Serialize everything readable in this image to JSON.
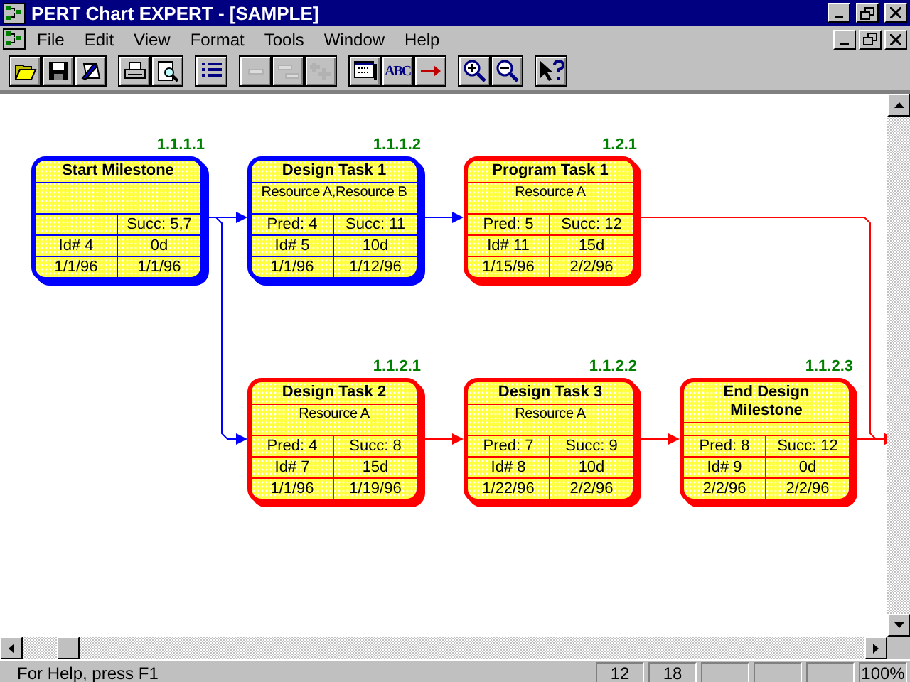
{
  "window": {
    "title": "PERT Chart EXPERT - [SAMPLE]"
  },
  "menu": [
    {
      "label": "File"
    },
    {
      "label": "Edit"
    },
    {
      "label": "View"
    },
    {
      "label": "Format"
    },
    {
      "label": "Tools"
    },
    {
      "label": "Window"
    },
    {
      "label": "Help"
    }
  ],
  "toolbar": [
    [
      {
        "kind": "open",
        "disabled": false
      },
      {
        "kind": "save",
        "disabled": false
      },
      {
        "kind": "edit",
        "disabled": false
      }
    ],
    [
      {
        "kind": "print",
        "disabled": false
      },
      {
        "kind": "preview",
        "disabled": false
      }
    ],
    [
      {
        "kind": "outline",
        "disabled": false
      }
    ],
    [
      {
        "kind": "minus",
        "disabled": true
      },
      {
        "kind": "ungroup",
        "disabled": true
      },
      {
        "kind": "plus",
        "disabled": true
      }
    ],
    [
      {
        "kind": "layout",
        "disabled": false
      },
      {
        "kind": "spelling",
        "label": "ABC",
        "disabled": false
      },
      {
        "kind": "link",
        "disabled": false
      }
    ],
    [
      {
        "kind": "zoomin",
        "disabled": false
      },
      {
        "kind": "zoomout",
        "disabled": false
      }
    ],
    [
      {
        "kind": "help",
        "disabled": false
      }
    ]
  ],
  "chart": {
    "rows": [
      {
        "nodes": [
          {
            "wbs": "1.1.1.1",
            "title": "Start Milestone",
            "critical": false,
            "succ": "Succ: 5,7",
            "id": "Id# 4",
            "duration": "0d",
            "start": "1/1/96",
            "finish": "1/1/96"
          },
          {
            "wbs": "1.1.1.2",
            "title": "Design Task 1",
            "critical": false,
            "resource": "Resource A,Resource B",
            "pred": "Pred: 4",
            "succ": "Succ: 11",
            "id": "Id# 5",
            "duration": "10d",
            "start": "1/1/96",
            "finish": "1/12/96"
          },
          {
            "wbs": "1.2.1",
            "title": "Program Task 1",
            "critical": true,
            "resource": "Resource A",
            "pred": "Pred: 5",
            "succ": "Succ: 12",
            "id": "Id# 11",
            "duration": "15d",
            "start": "1/15/96",
            "finish": "2/2/96"
          }
        ]
      },
      {
        "nodes": [
          {
            "wbs": "1.1.2.1",
            "title": "Design Task 2",
            "critical": true,
            "resource": "Resource A",
            "pred": "Pred: 4",
            "succ": "Succ: 8",
            "id": "Id# 7",
            "duration": "15d",
            "start": "1/1/96",
            "finish": "1/19/96"
          },
          {
            "wbs": "1.1.2.2",
            "title": "Design Task 3",
            "critical": true,
            "resource": "Resource A",
            "pred": "Pred: 7",
            "succ": "Succ: 9",
            "id": "Id# 8",
            "duration": "10d",
            "start": "1/22/96",
            "finish": "2/2/96"
          },
          {
            "wbs": "1.1.2.3",
            "title": "End Design Milestone",
            "critical": true,
            "pred": "Pred: 8",
            "succ": "Succ: 12",
            "id": "Id# 9",
            "duration": "0d",
            "start": "2/2/96",
            "finish": "2/2/96"
          }
        ]
      }
    ]
  },
  "status_bar": {
    "message": "For Help, press F1",
    "panes": [
      "12",
      "18"
    ],
    "zoom": "100%"
  }
}
